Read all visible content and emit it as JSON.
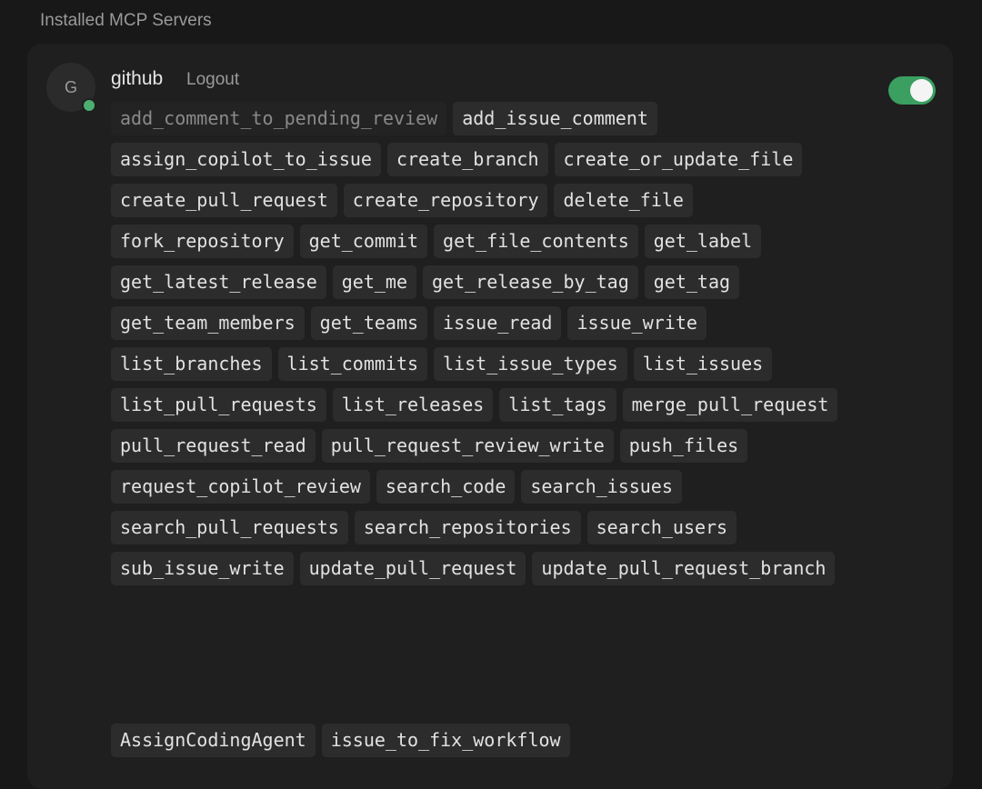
{
  "section": {
    "title": "Installed MCP Servers"
  },
  "server": {
    "avatar_letter": "G",
    "name": "github",
    "logout_label": "Logout",
    "enabled": true,
    "status": "connected",
    "colors": {
      "status_dot": "#4caf72",
      "toggle_on": "#3a9f61"
    },
    "tools": [
      {
        "name": "add_comment_to_pending_review",
        "enabled": false
      },
      {
        "name": "add_issue_comment",
        "enabled": true
      },
      {
        "name": "assign_copilot_to_issue",
        "enabled": true
      },
      {
        "name": "create_branch",
        "enabled": true
      },
      {
        "name": "create_or_update_file",
        "enabled": true
      },
      {
        "name": "create_pull_request",
        "enabled": true
      },
      {
        "name": "create_repository",
        "enabled": true
      },
      {
        "name": "delete_file",
        "enabled": true
      },
      {
        "name": "fork_repository",
        "enabled": true
      },
      {
        "name": "get_commit",
        "enabled": true
      },
      {
        "name": "get_file_contents",
        "enabled": true
      },
      {
        "name": "get_label",
        "enabled": true
      },
      {
        "name": "get_latest_release",
        "enabled": true
      },
      {
        "name": "get_me",
        "enabled": true
      },
      {
        "name": "get_release_by_tag",
        "enabled": true
      },
      {
        "name": "get_tag",
        "enabled": true
      },
      {
        "name": "get_team_members",
        "enabled": true
      },
      {
        "name": "get_teams",
        "enabled": true
      },
      {
        "name": "issue_read",
        "enabled": true
      },
      {
        "name": "issue_write",
        "enabled": true
      },
      {
        "name": "list_branches",
        "enabled": true
      },
      {
        "name": "list_commits",
        "enabled": true
      },
      {
        "name": "list_issue_types",
        "enabled": true
      },
      {
        "name": "list_issues",
        "enabled": true
      },
      {
        "name": "list_pull_requests",
        "enabled": true
      },
      {
        "name": "list_releases",
        "enabled": true
      },
      {
        "name": "list_tags",
        "enabled": true
      },
      {
        "name": "merge_pull_request",
        "enabled": true
      },
      {
        "name": "pull_request_read",
        "enabled": true
      },
      {
        "name": "pull_request_review_write",
        "enabled": true
      },
      {
        "name": "push_files",
        "enabled": true
      },
      {
        "name": "request_copilot_review",
        "enabled": true
      },
      {
        "name": "search_code",
        "enabled": true
      },
      {
        "name": "search_issues",
        "enabled": true
      },
      {
        "name": "search_pull_requests",
        "enabled": true
      },
      {
        "name": "search_repositories",
        "enabled": true
      },
      {
        "name": "search_users",
        "enabled": true
      },
      {
        "name": "sub_issue_write",
        "enabled": true
      },
      {
        "name": "update_pull_request",
        "enabled": true
      },
      {
        "name": "update_pull_request_branch",
        "enabled": true
      }
    ],
    "extra_tools": [
      {
        "name": "AssignCodingAgent",
        "enabled": true
      },
      {
        "name": "issue_to_fix_workflow",
        "enabled": true
      }
    ]
  }
}
